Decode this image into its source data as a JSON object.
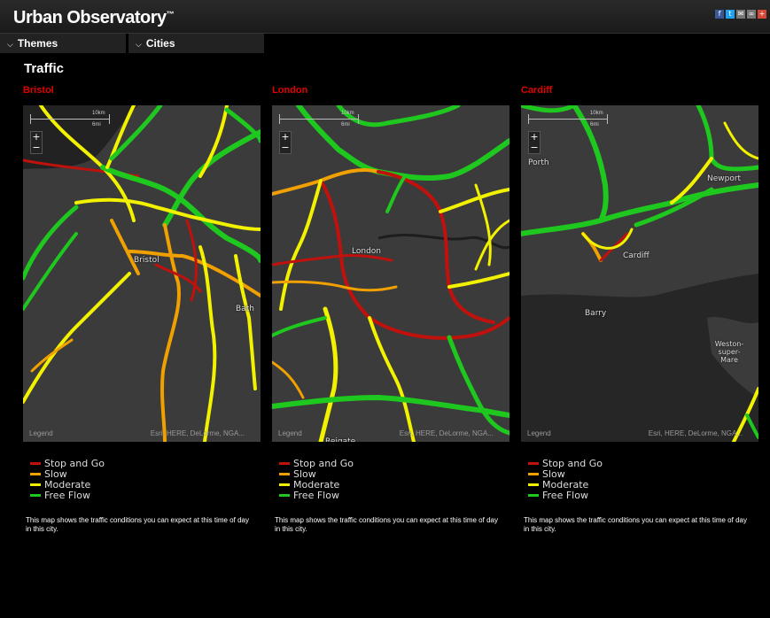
{
  "app": {
    "title": "Urban Observatory",
    "trademark": "™",
    "share_icons": [
      {
        "name": "facebook-icon",
        "glyph": "f",
        "color": "#3b5998"
      },
      {
        "name": "twitter-icon",
        "glyph": "t",
        "color": "#1da1f2"
      },
      {
        "name": "email-icon",
        "glyph": "✉",
        "color": "#777777"
      },
      {
        "name": "link-icon",
        "glyph": "∞",
        "color": "#777777"
      },
      {
        "name": "google-plus-icon",
        "glyph": "+",
        "color": "#d34836"
      }
    ]
  },
  "menu": {
    "themes_label": "Themes",
    "cities_label": "Cities"
  },
  "page": {
    "title": "Traffic"
  },
  "colors": {
    "city_name": "#e00000",
    "stop_and_go": "#c0110c",
    "slow": "#f0a000",
    "moderate": "#f2f200",
    "free_flow": "#1ec81e"
  },
  "legend": [
    {
      "label": "Stop and Go",
      "color": "#c0110c"
    },
    {
      "label": "Slow",
      "color": "#f0a000"
    },
    {
      "label": "Moderate",
      "color": "#f2f200"
    },
    {
      "label": "Free Flow",
      "color": "#1ec81e"
    }
  ],
  "map_common": {
    "scale_km": "10km",
    "scale_mi": "6mi",
    "zoom_in": "+",
    "zoom_out": "−",
    "legend_button": "Legend",
    "attribution": "Esri, HERE, DeLorme, NGA..."
  },
  "cities": [
    {
      "name": "Bristol",
      "places": [
        "Bristol",
        "Bath"
      ],
      "description": "This map shows the traffic conditions you can expect at this time of day in this city."
    },
    {
      "name": "London",
      "places": [
        "London",
        "Reigate"
      ],
      "description": "This map shows the traffic conditions you can expect at this time of day in this city."
    },
    {
      "name": "Cardiff",
      "places": [
        "Cardiff",
        "Newport",
        "Barry",
        "Weston-super-Mare",
        "Porth"
      ],
      "description": "This map shows the traffic conditions you can expect at this time of day in this city."
    }
  ]
}
